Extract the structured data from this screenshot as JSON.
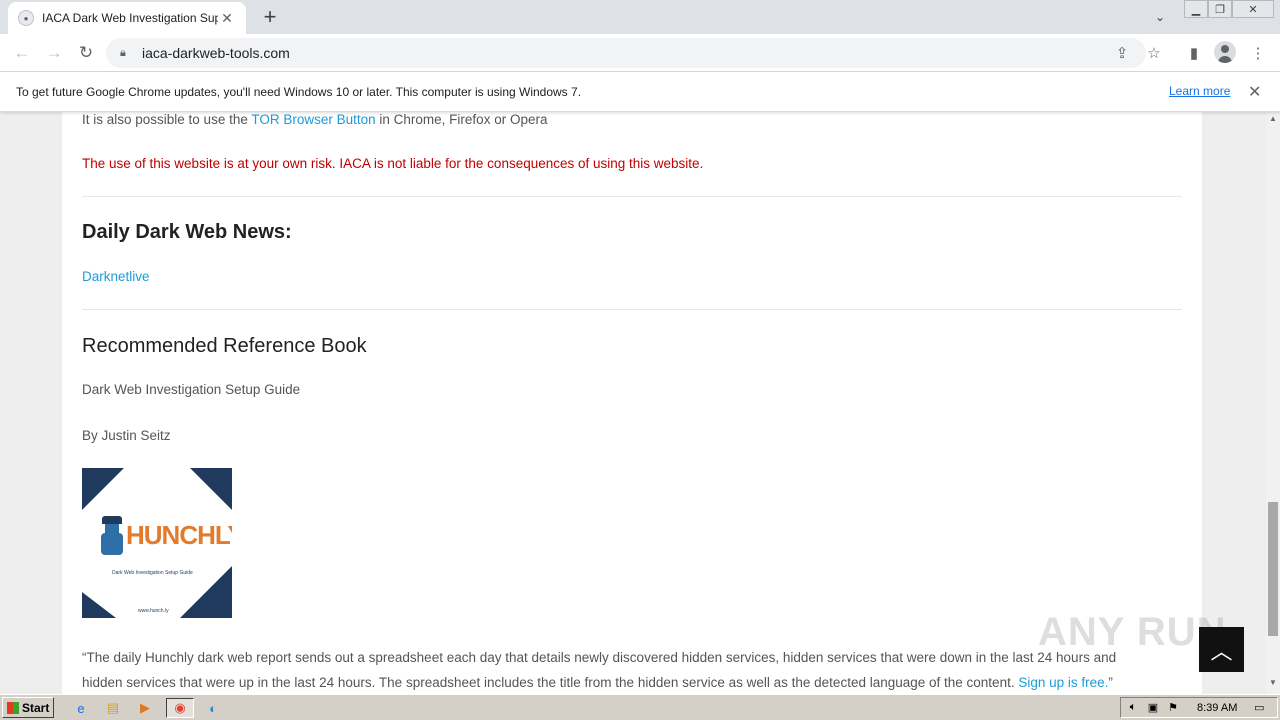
{
  "browser": {
    "tab_title": "IACA Dark Web Investigation Suppo",
    "url": "iaca-darkweb-tools.com",
    "infobar_text": "To get future Google Chrome updates, you'll need Windows 10 or later. This computer is using Windows 7.",
    "infobar_link": "Learn more"
  },
  "page": {
    "tor_text_pre": "It is also possible to use the ",
    "tor_link": "TOR Browser Button",
    "tor_text_post": " in Chrome, Firefox or Opera",
    "risk_notice": "The use of this website is at your own risk. IACA is not liable for the consequences of using this website.",
    "news_heading": "Daily Dark Web News:",
    "news_link": "Darknetlive",
    "book_heading": "Recommended Reference Book",
    "book_title": "Dark Web Investigation Setup Guide",
    "book_author": "By Justin Seitz",
    "book_cover": {
      "brand": "HUNCHLY",
      "subtitle": "Dark Web Investigation Setup Guide",
      "url": "www.hunch.ly"
    },
    "quote_line1": "“The daily Hunchly dark web report sends out a spreadsheet each day that details newly discovered hidden services, hidden services that were down in the last 24 hours and",
    "quote_line2_pre": "hidden services that were up in the last 24 hours. The spreadsheet includes the title from the hidden service as well as the detected language of the content. ",
    "quote_link": "Sign up is free.",
    "quote_line2_post": "”"
  },
  "overlay": {
    "watermark": "ANY RUN"
  },
  "taskbar": {
    "start_label": "Start",
    "clock": "8:39 AM"
  },
  "colors": {
    "link": "#1e9bd7",
    "warning": "#c00000",
    "brand_orange": "#e47b2c",
    "brand_navy": "#1f3a5c"
  }
}
